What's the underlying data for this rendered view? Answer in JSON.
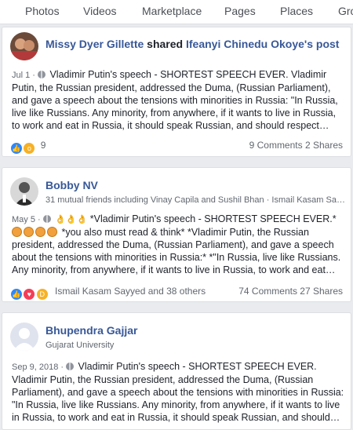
{
  "tabs": [
    "Photos",
    "Videos",
    "Marketplace",
    "Pages",
    "Places",
    "Groups"
  ],
  "posts": [
    {
      "author": "Missy Dyer Gillette",
      "shared_word": "shared",
      "shared_from": "Ifeanyi Chinedu Okoye's post",
      "date": "Jul 1 ·",
      "body": "Vladimir Putin's speech - SHORTEST SPEECH EVER. Vladimir Putin, the Russian president, addressed the Duma, (Russian Parliament), and gave a speech about the tensions with minorities in Russia: \"In Russia, live like Russians. Any minority, from anywhere, if it wants to live in Russia, to work and eat in Russia, it should speak Russian, and should respect…",
      "reaction_count": "9",
      "comments": "9 Comments",
      "shares": "2 Shares"
    },
    {
      "author": "Bobby NV",
      "subline": "31 mutual friends including Vinay Capila and Sushil Bhan · Ismail Kasam Say…",
      "date": "May 5 ·",
      "body_start": "*Vladimir Putin's speech - SHORTEST SPEECH EVER.*",
      "body_rest": "*you also must read & think* *Vladimir Putin, the Russian president, addressed the Duma, (Russian Parliament), and gave a speech about the tensions with minorities in Russia:* *\"In Russia, live like Russians. Any minority, from anywhere, if it wants to live in Russia, to work and eat…",
      "reaction_people": "Ismail Kasam Sayyed and 38 others",
      "comments": "74 Comments",
      "shares": "27 Shares"
    },
    {
      "author": "Bhupendra Gajjar",
      "subline": "Gujarat University",
      "date": "Sep 9, 2018 ·",
      "body": "Vladimir Putin's speech - SHORTEST SPEECH EVER. Vladimir Putin, the Russian president, addressed the Duma, (Russian Parliament), and gave a speech about the tensions with minorities in Russia: \"In Russia, live like Russians. Any minority, from anywhere, if it wants to live in Russia, to work and eat in Russia, it should speak Russian, and should…"
    }
  ],
  "colors": {
    "link": "#385898",
    "like": "#2d88ff",
    "wow": "#f7b125",
    "love": "#f33e58"
  }
}
